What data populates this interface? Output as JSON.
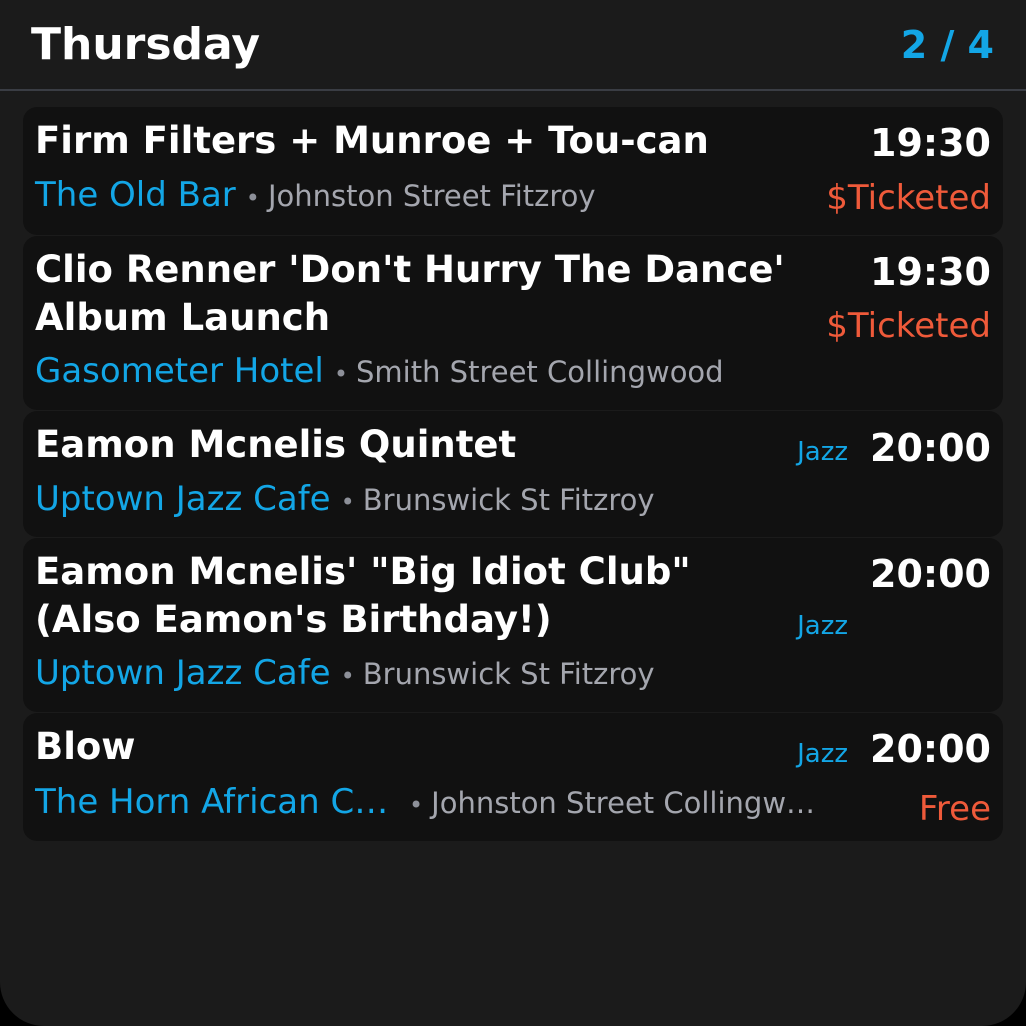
{
  "header": {
    "title": "Thursday",
    "pager": "2 / 4"
  },
  "colors": {
    "background": "#1b1b1b",
    "card": "#111111",
    "accent": "#13a6e6",
    "price": "#ef5a3a",
    "text": "#ffffff",
    "muted": "#a4a6ae"
  },
  "events": [
    {
      "title": "Firm Filters + Munroe + Tou-can",
      "time": "19:30",
      "venue": "The Old Bar",
      "separator": "•",
      "address": "Johnston Street Fitzroy",
      "price": "$Ticketed"
    },
    {
      "title_line1": "Clio Renner 'Don't Hurry The Dance'",
      "title_line2": "Album Launch",
      "time": "19:30",
      "venue": "Gasometer Hotel",
      "separator": "•",
      "address": "Smith Street Collingwood",
      "price": "$Ticketed"
    },
    {
      "title": "Eamon Mcnelis Quintet",
      "genre": "Jazz",
      "time": "20:00",
      "venue": "Uptown Jazz Cafe",
      "separator": "•",
      "address": "Brunswick St Fitzroy"
    },
    {
      "title_line1": "Eamon Mcnelis' \"Big Idiot Club\"",
      "title_line2": "(Also Eamon's Birthday!)",
      "genre": "Jazz",
      "time": "20:00",
      "venue": "Uptown Jazz Cafe",
      "separator": "•",
      "address": "Brunswick St Fitzroy"
    },
    {
      "title": "Blow",
      "genre": "Jazz",
      "time": "20:00",
      "venue": "The Horn African C…",
      "separator": "•",
      "address": "Johnston Street Collingw…",
      "price": "Free"
    }
  ]
}
